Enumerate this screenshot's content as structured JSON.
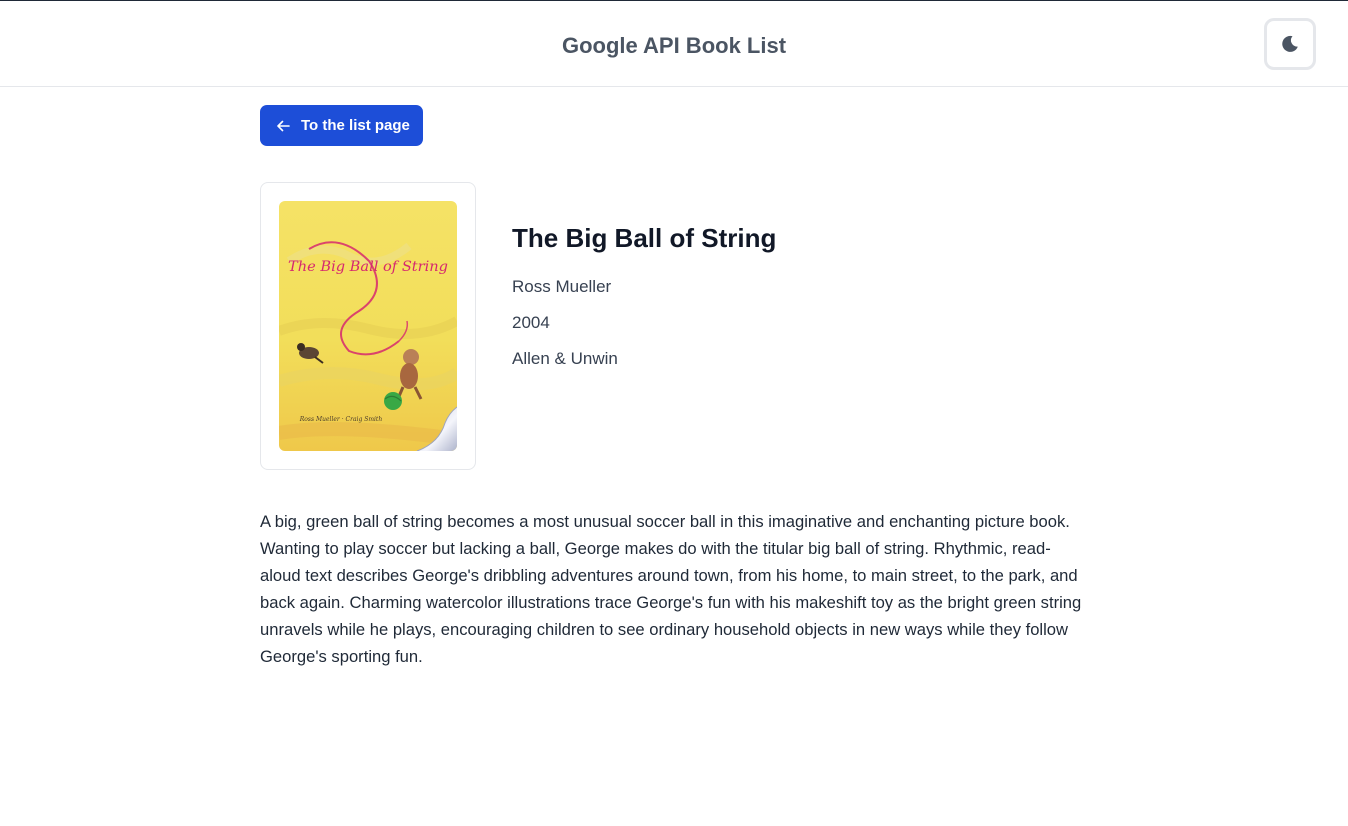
{
  "header": {
    "title": "Google API Book List",
    "theme_toggle_icon": "moon-icon"
  },
  "nav": {
    "back_label": "To the list page",
    "back_icon": "arrow-left-icon"
  },
  "book": {
    "title": "The Big Ball of String",
    "author": "Ross Mueller",
    "year": "2004",
    "publisher": "Allen & Unwin",
    "description": "A big, green ball of string becomes a most unusual soccer ball in this imaginative and enchanting picture book. Wanting to play soccer but lacking a ball, George makes do with the titular big ball of string. Rhythmic, read-aloud text describes George's dribbling adventures around town, from his home, to main street, to the park, and back again. Charming watercolor illustrations trace George's fun with his makeshift toy as the bright green string unravels while he plays, encouraging children to see ordinary household objects in new ways while they follow George's sporting fun.",
    "cover": {
      "title_text": "The Big Ball of String",
      "authors_text": "Ross Mueller · Craig Smith"
    }
  },
  "colors": {
    "accent": "#1d4ed8",
    "header_text": "#4b5563",
    "cover_title": "#d6286f",
    "cover_background": "#f4de5c"
  }
}
